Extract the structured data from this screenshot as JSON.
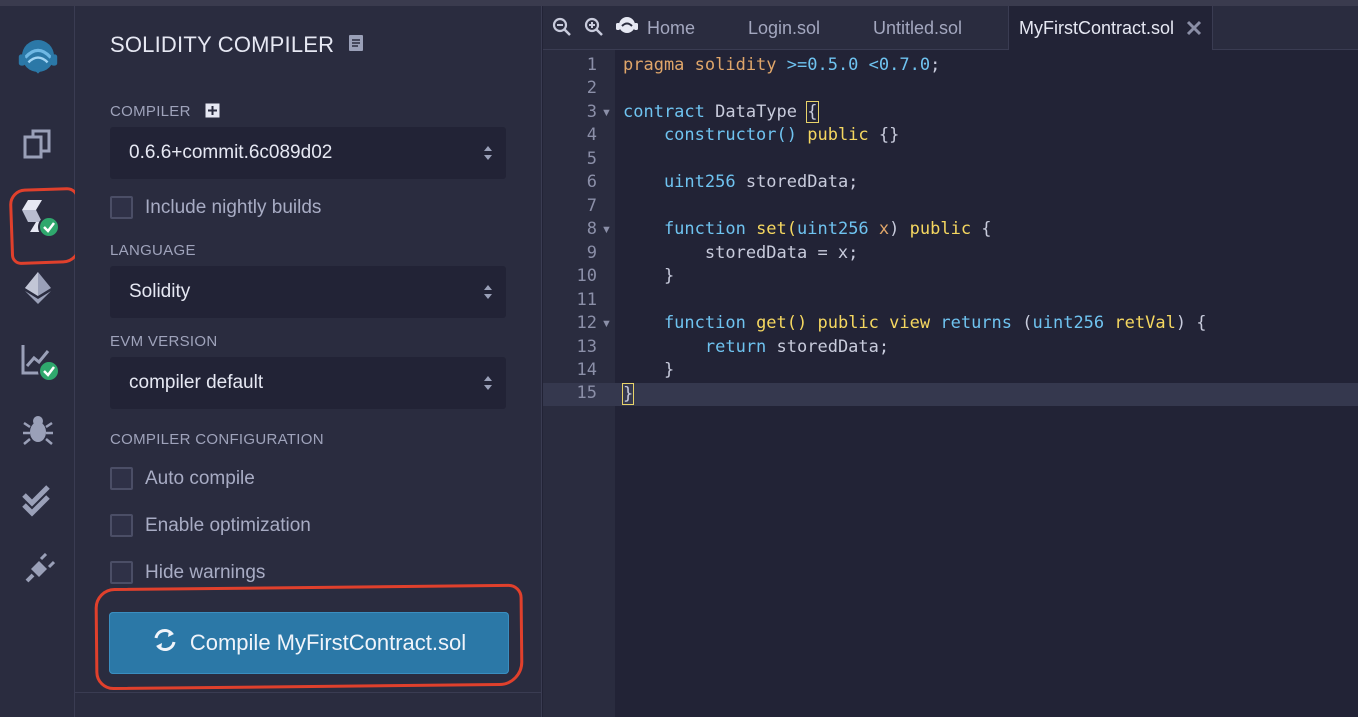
{
  "panel": {
    "title": "SOLIDITY COMPILER",
    "compiler_label": "COMPILER",
    "compiler_value": "0.6.6+commit.6c089d02",
    "nightly_label": "Include nightly builds",
    "language_label": "LANGUAGE",
    "language_value": "Solidity",
    "evm_label": "EVM VERSION",
    "evm_value": "compiler default",
    "config_label": "COMPILER CONFIGURATION",
    "auto_compile_label": "Auto compile",
    "optimization_label": "Enable optimization",
    "hide_warnings_label": "Hide warnings",
    "compile_button_label": "Compile MyFirstContract.sol"
  },
  "tabs": [
    {
      "label": "Home"
    },
    {
      "label": "Login.sol"
    },
    {
      "label": "Untitled.sol"
    },
    {
      "label": "MyFirstContract.sol"
    }
  ],
  "editor": {
    "line_numbers": [
      "1",
      "2",
      "3",
      "4",
      "5",
      "6",
      "7",
      "8",
      "9",
      "10",
      "11",
      "12",
      "13",
      "14",
      "15"
    ],
    "code": {
      "l1": {
        "a": "pragma solidity",
        "b": " >=0.5.0 <0.7.0",
        "c": ";"
      },
      "l3": {
        "a": "contract",
        "b": " DataType ",
        "c": "{"
      },
      "l4": {
        "a": "    constructor() ",
        "b": "public",
        "c": " {}"
      },
      "l6": {
        "a": "    uint256",
        "b": " storedData;"
      },
      "l8": {
        "a": "    function",
        "b": " set(",
        "c": "uint256",
        "d": " x",
        "e": ") ",
        "f": "public",
        "g": " {"
      },
      "l9": {
        "a": "        storedData = x;"
      },
      "l10": {
        "a": "    }"
      },
      "l12": {
        "a": "    function",
        "b": " get() ",
        "c": "public",
        "d": " ",
        "e": "view",
        "f": " ",
        "g": "returns",
        "h": " (",
        "i": "uint256",
        "j": " retVal",
        "k": ") {"
      },
      "l13": {
        "a": "        return",
        "b": " storedData;"
      },
      "l14": {
        "a": "    }"
      },
      "l15": {
        "a": "}"
      }
    }
  },
  "colors": {
    "accent_button": "#2b78a7",
    "success_badge": "#2fa86d",
    "annotation_red": "#e0402c",
    "keyword_yellow": "#f5d760",
    "type_blue": "#6fc3f0"
  },
  "icons": {
    "logo": "remix-logo-icon",
    "file_explorer": "file-explorer-icon",
    "solidity_compiler": "solidity-compiler-icon",
    "deploy": "ethereum-deploy-icon",
    "analysis": "analysis-chart-icon",
    "debugger": "bug-icon",
    "tests": "double-check-icon",
    "plugins": "plug-icon"
  }
}
